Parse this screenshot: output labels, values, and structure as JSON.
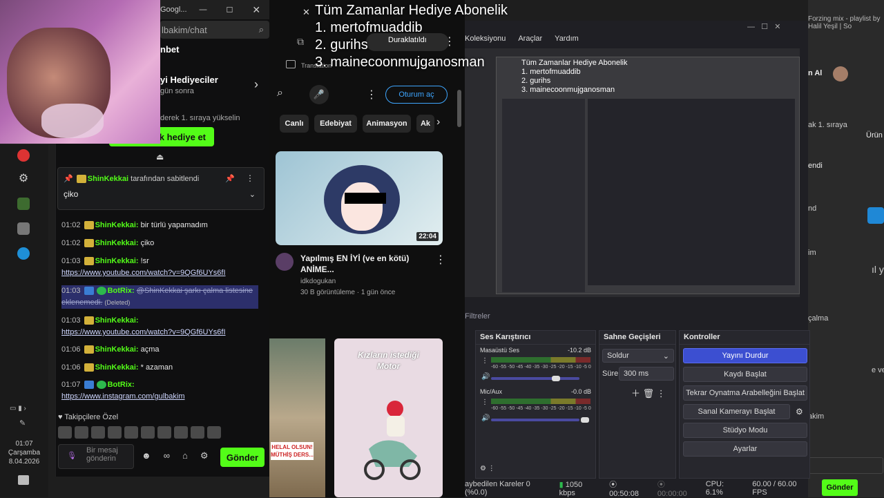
{
  "overlay": {
    "title": "Tüm Zamanlar Hediye  Abonelik",
    "line1": "1. mertofmuaddib",
    "line2": "2. gurihs",
    "line3": "3. mainecoonmujganosman"
  },
  "chat_window": {
    "tab_fragment": "Googl...",
    "url_fragment": "lbakim/chat",
    "header_fragment": "nbet",
    "gift_title_fragment": "yi Hediyeciler",
    "gift_sub_fragment": "gün sonra",
    "rank_fragment": "derek 1. sıraya yükselin",
    "gift_button": "lik hediye et",
    "pinned": {
      "user": "ShinKekkai",
      "by_suffix": " tarafından sabitlendi",
      "message": "çiko"
    },
    "messages": [
      {
        "time": "01:02",
        "user": "ShinKekkai:",
        "text": "bir türlü yapamadım"
      },
      {
        "time": "01:02",
        "user": "ShinKekkai:",
        "text": "çiko"
      },
      {
        "time": "01:03",
        "user": "ShinKekkai:",
        "text": "!sr",
        "link": "https://www.youtube.com/watch?v=9QGf6UYs6fI"
      },
      {
        "time": "01:03",
        "user": "BotRix:",
        "text": "@ShinKekkai şarkı çalma listesine eklenemedi.",
        "deleted": "(Deleted)"
      },
      {
        "time": "01:03",
        "user": "ShinKekkai:",
        "link": "https://www.youtube.com/watch?v=9QGf6UYs6fI"
      },
      {
        "time": "01:06",
        "user": "ShinKekkai:",
        "text": "açma"
      },
      {
        "time": "01:06",
        "user": "ShinKekkai:",
        "text": "* azaman"
      },
      {
        "time": "01:07",
        "user": "BotRix:",
        "link": "https://www.instagram.com/gulbakim"
      }
    ],
    "followers_label": "Takipçilere Özel",
    "input_placeholder": "Bir mesaj gönderin",
    "send_button": "Gönder"
  },
  "taskbar": {
    "time": "01:07",
    "day": "Çarşamba",
    "date": "8.04.2026"
  },
  "youtube": {
    "paused_label": "Duraklatıldı",
    "bookmark_fragment": "Translation",
    "signin_button": "Oturum aç",
    "chips": [
      "Canlı",
      "Edebiyat",
      "Animasyon",
      "Ak"
    ],
    "thumb_duration": "22:04",
    "video_title": "Yapılmış EN İYİ (ve en kötü) ANİME...",
    "channel": "idkdogukan",
    "meta": "30 B görüntüleme · 1 gün önce",
    "short1_tag_line1": "HELAL OLSUN!",
    "short1_tag_line2": "MÜTHİŞ DERS...",
    "short2_caption_line1": "Kızların istediği",
    "short2_caption_line2": "Motor"
  },
  "obs": {
    "menu": [
      "Koleksiyonu",
      "Araçlar",
      "Yardım"
    ],
    "filters": "Filtreler",
    "mixer_title": "Ses Karıştırıcı",
    "desktop_audio": "Masaüstü Ses",
    "desktop_db": "-10.2 dB",
    "mic": "Mic/Aux",
    "mic_db": "-0.0 dB",
    "meter_scale": "-60 -55 -50 -45 -40 -35 -30 -25 -20 -15 -10 -5 0",
    "transitions_title": "Sahne Geçişleri",
    "transition": "Soldur",
    "duration_label": "Süre",
    "duration": "300 ms",
    "controls_title": "Kontroller",
    "controls": [
      "Yayını Durdur",
      "Kaydı Başlat",
      "Tekrar Oynatma Arabelleğini Başlat",
      "Sanal Kamerayı Başlat",
      "Stüdyo Modu",
      "Ayarlar"
    ],
    "status": {
      "dropped": "aybedilen Kareler 0 (%0.0)",
      "bitrate": "1050 kbps",
      "stream_time": "00:50:08",
      "rec_time": "00:00:00",
      "cpu": "CPU: 6.1%",
      "fps": "60.00 / 60.00 FPS"
    },
    "preview_overlay": {
      "title": "Tüm Zamanlar Hediye  Abonelik",
      "line1": "1. mertofmuaddib",
      "line2": "2. gurihs",
      "line3": "3. mainecoonmujganosman"
    }
  },
  "right_window": {
    "tab_fragment": "Forzing mix - playlist by Halil Yeşil | So",
    "name_fragment": "n Al",
    "rank_fragment": "ak 1. sıraya",
    "side_words": [
      "Ürün",
      "endi",
      "nd",
      "im",
      "ıl ya",
      "çalma",
      "e ve",
      "akim"
    ],
    "send_button": "Gönder"
  }
}
